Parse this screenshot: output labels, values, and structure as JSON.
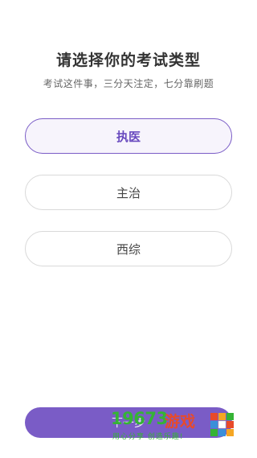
{
  "header": {
    "title": "请选择你的考试类型",
    "subtitle": "考试这件事，三分天注定，七分靠刷题"
  },
  "options": [
    {
      "label": "执医",
      "selected": true
    },
    {
      "label": "主治",
      "selected": false
    },
    {
      "label": "西综",
      "selected": false
    }
  ],
  "footer": {
    "button_label": "下一步"
  },
  "watermark": {
    "number": "19673",
    "brand": "游戏",
    "slogan": "用心分享 创造乐趣!"
  },
  "colors": {
    "accent": "#7a5cc6",
    "selected_bg": "#f7f4fc",
    "border": "#d9d9d9",
    "title": "#333333",
    "subtitle": "#666666",
    "watermark_green": "#35b335",
    "watermark_red": "#e84a2a"
  }
}
